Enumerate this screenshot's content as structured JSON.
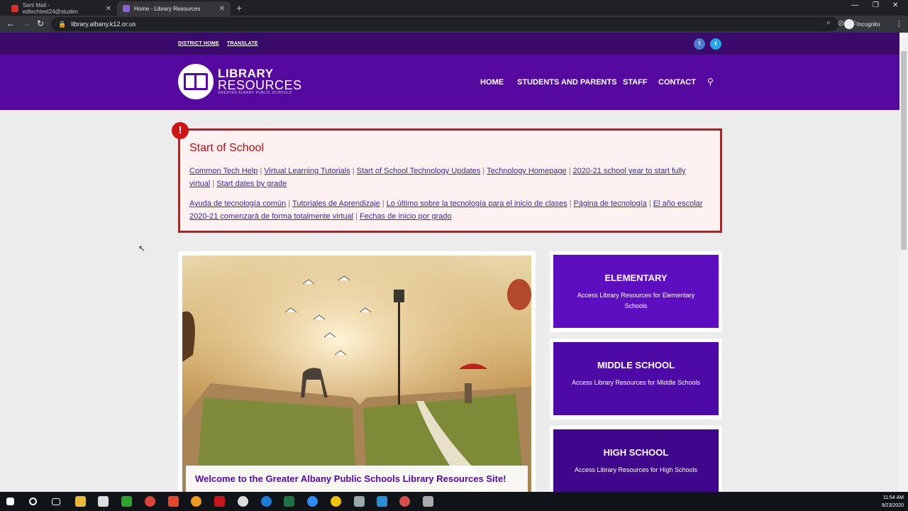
{
  "browser": {
    "tabs": [
      {
        "title": "Sent Mail - edtechtest24@studen",
        "active": false
      },
      {
        "title": "Home - Library Resources",
        "active": true
      }
    ],
    "url": "library.albany.k12.or.us",
    "profile": "Incognito"
  },
  "site": {
    "top_links": [
      "DISTRICT HOME",
      "TRANSLATE"
    ],
    "social": [
      "f",
      "t"
    ],
    "logo": {
      "line1": "LIBRARY",
      "line2": "RESOURCES",
      "line3": "GREATER ALBANY PUBLIC SCHOOLS"
    },
    "nav": [
      "HOME",
      "STUDENTS AND PARENTS",
      "STAFF",
      "CONTACT"
    ],
    "accent_color": "#56099e",
    "alert_color": "#d01313"
  },
  "alert": {
    "badge": "!",
    "title": "Start of School",
    "english_links": [
      "Common Tech Help",
      "Virtual Learning Tutorials",
      "Start of School Technology Updates",
      "Technology Homepage",
      "2020-21 school year to start fully virtual",
      "Start dates by grade "
    ],
    "spanish_links": [
      "Ayuda de tecnología común",
      "Tutoriales de Aprendizaje",
      "Lo último sobre la tecnología para el inicio de clases",
      "Página de tecnología",
      "El año escolar 2020-21 comenzará de forma totalmente virtual",
      "Fechas de inicio por grado"
    ],
    "separator": "|"
  },
  "hero": {
    "caption": "Welcome to the Greater Albany Public Schools Library Resources Site!"
  },
  "side_cards": [
    {
      "title": "ELEMENTARY",
      "subtitle": "Access Library Resources for Elementary Schools",
      "color": "#5d0fc0"
    },
    {
      "title": "MIDDLE SCHOOL",
      "subtitle": "Access Library Resources for Middle Schools",
      "color": "#4d0aa6"
    },
    {
      "title": "HIGH SCHOOL",
      "subtitle": "Access Library Resources for High Schools",
      "color": "#3f078c"
    }
  ],
  "taskbar": {
    "time": "11:54 AM",
    "date": "9/23/2020"
  }
}
